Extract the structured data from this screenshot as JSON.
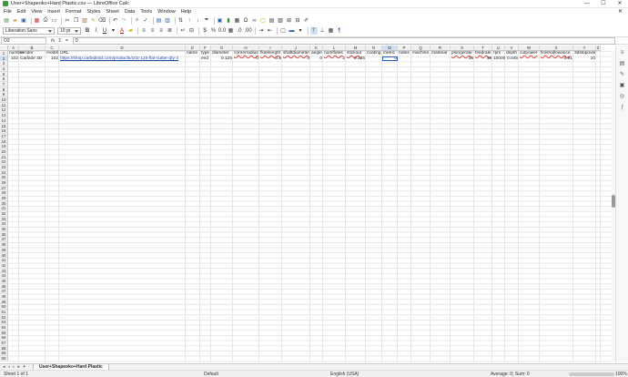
{
  "window": {
    "title": "User+Shapeoko+Hard Plastic.csv — LibreOffice Calc",
    "min": "—",
    "max": "☐",
    "close": "✕"
  },
  "menu": [
    "File",
    "Edit",
    "View",
    "Insert",
    "Format",
    "Styles",
    "Sheet",
    "Data",
    "Tools",
    "Window",
    "Help"
  ],
  "font": {
    "name": "Liberation Sans",
    "size": "10 pt"
  },
  "namebox": "O2",
  "formula": {
    "fx": "fx",
    "sum": "Σ",
    "eq": "=",
    "value": "0"
  },
  "columns": [
    {
      "id": "A",
      "label": "A",
      "w": 12
    },
    {
      "id": "B",
      "label": "B",
      "w": 29
    },
    {
      "id": "C",
      "label": "C",
      "w": 15
    },
    {
      "id": "D",
      "label": "D",
      "w": 139
    },
    {
      "id": "E",
      "label": "E",
      "w": 16
    },
    {
      "id": "F",
      "label": "F",
      "w": 12
    },
    {
      "id": "G",
      "label": "G",
      "w": 24
    },
    {
      "id": "H",
      "label": "H",
      "w": 29
    },
    {
      "id": "I",
      "label": "I",
      "w": 25
    },
    {
      "id": "J",
      "label": "J",
      "w": 31
    },
    {
      "id": "K",
      "label": "K",
      "w": 14
    },
    {
      "id": "L",
      "label": "L",
      "w": 25
    },
    {
      "id": "M",
      "label": "M",
      "w": 22
    },
    {
      "id": "N",
      "label": "N",
      "w": 18
    },
    {
      "id": "O",
      "label": "O",
      "w": 17
    },
    {
      "id": "P",
      "label": "P",
      "w": 15
    },
    {
      "id": "Q",
      "label": "Q",
      "w": 21
    },
    {
      "id": "R",
      "label": "R",
      "w": 22
    },
    {
      "id": "S",
      "label": "S",
      "w": 26
    },
    {
      "id": "T",
      "label": "T",
      "w": 20
    },
    {
      "id": "U",
      "label": "U",
      "w": 14
    },
    {
      "id": "V",
      "label": "V",
      "w": 15
    },
    {
      "id": "W",
      "label": "W",
      "w": 23
    },
    {
      "id": "X",
      "label": "X",
      "w": 37
    },
    {
      "id": "Y",
      "label": "Y",
      "w": 25
    },
    {
      "id": "Z",
      "label": "Z",
      "w": 5
    }
  ],
  "row1": [
    "number",
    "vendor",
    "model",
    "URL",
    "name",
    "type",
    "diameter",
    "cornerradius",
    "flutelength",
    "shaftdiameter",
    "angle",
    "numflutes",
    "stickout",
    "coating",
    "metric",
    "notes",
    "machine",
    "material",
    "plungerate",
    "feedrate",
    "rpm",
    "depth",
    "cutpower",
    "finishallowance",
    "3dstepover",
    ""
  ],
  "row2": [
    "102",
    "Carbide 3D",
    "102",
    "https://shop.carbide3d.com/products/102-125-flat-cutter-qty-2",
    "",
    "end",
    "0.125",
    "0",
    "0.5",
    "0",
    "0",
    "2",
    "0.125",
    "",
    "0",
    "",
    "",
    "",
    "15",
    "45",
    "10000",
    "0.045",
    "",
    "0.01",
    "10",
    ""
  ],
  "rows": [
    "1",
    "2",
    "3",
    "4",
    "5",
    "6",
    "7",
    "8",
    "9",
    "10",
    "11",
    "12",
    "13",
    "14",
    "15",
    "16",
    "17",
    "18",
    "19",
    "20",
    "21",
    "22",
    "23",
    "24",
    "25",
    "26",
    "27",
    "28",
    "29",
    "30",
    "31",
    "32",
    "33",
    "34",
    "35",
    "36",
    "37",
    "38",
    "39",
    "40",
    "41",
    "42",
    "43",
    "44",
    "45",
    "46",
    "47",
    "48",
    "49",
    "50",
    "51",
    "52",
    "53",
    "54",
    "55",
    "56",
    "57",
    "58",
    "59",
    "60"
  ],
  "sheet_tab": "User+Shapeoko+Hard Plastic",
  "status": {
    "sheet": "Sheet 1 of 1",
    "style": "Default",
    "lang": "English (USA)",
    "calc": "Average: 0; Sum: 0",
    "zoom": "100%"
  }
}
